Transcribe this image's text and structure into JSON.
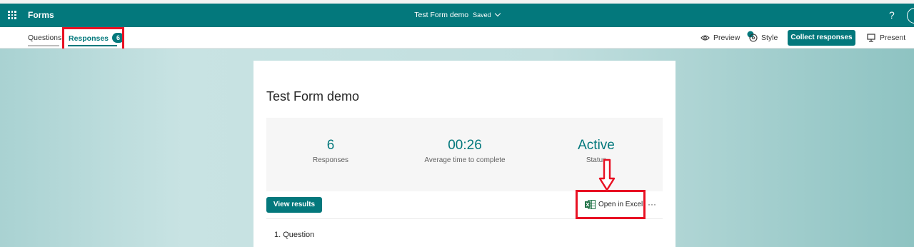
{
  "app": {
    "name": "Forms",
    "help_glyph": "?"
  },
  "document": {
    "title": "Test Form demo",
    "save_status": "Saved"
  },
  "tabs": [
    {
      "label": "Questions",
      "active": false
    },
    {
      "label": "Responses",
      "active": true,
      "badge": "6"
    }
  ],
  "toolbar": {
    "preview_label": "Preview",
    "style_label": "Style",
    "collect_label": "Collect responses",
    "present_label": "Present"
  },
  "form": {
    "title": "Test Form demo",
    "stats": [
      {
        "value": "6",
        "label": "Responses"
      },
      {
        "value": "00:26",
        "label": "Average time to complete"
      },
      {
        "value": "Active",
        "label": "Status"
      }
    ],
    "view_results_label": "View results",
    "open_excel_label": "Open in Excel",
    "more_glyph": "···",
    "questions": [
      {
        "label": "1.  Question"
      }
    ]
  },
  "colors": {
    "brand": "#03787c",
    "highlight": "#e81123"
  },
  "icons": [
    "waffle-icon",
    "chevron-down-icon",
    "help-icon",
    "eye-icon",
    "palette-icon",
    "present-icon",
    "excel-icon",
    "more-icon",
    "down-arrow-annotation"
  ]
}
